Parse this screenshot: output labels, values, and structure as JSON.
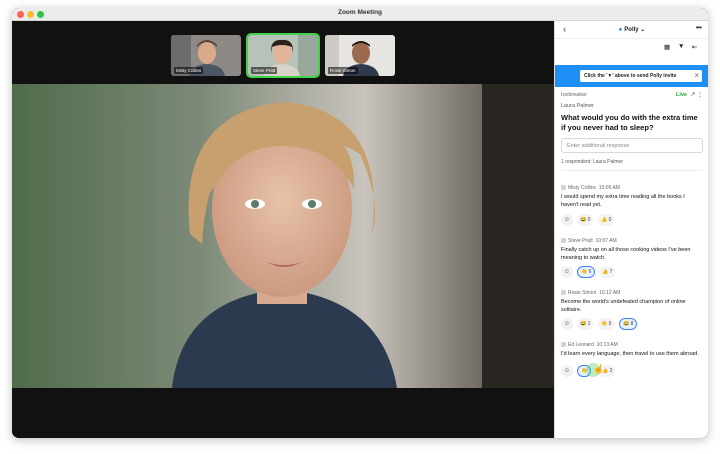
{
  "window": {
    "title": "Zoom Meeting"
  },
  "participants": [
    {
      "name": "Misty Collins",
      "active": false
    },
    {
      "name": "Steve Pratt",
      "active": true
    },
    {
      "name": "Rosie Simon",
      "active": false
    }
  ],
  "panel": {
    "brand": "Polly",
    "banner_text": "Click the '▼' above to send Polly invite",
    "poll_type": "Icebreaker",
    "live_label": "Live",
    "host": "Laura Palmer",
    "question": "What would you do with the extra time if you never had to sleep?",
    "response_placeholder": "Enter additional response",
    "respondent_count": "1 respondent: Laura Palmer",
    "responses": [
      {
        "author": "Misty Collins",
        "time": "10:06 AM",
        "text": "I would spend my extra time reading all the books I haven't read yet.",
        "reactions": [
          {
            "emoji": "😂",
            "count": "0",
            "selected": false
          },
          {
            "emoji": "👍",
            "count": "0",
            "selected": false
          }
        ]
      },
      {
        "author": "Steve Pratt",
        "time": "10:07 AM",
        "text": "Finally catch up on all those cooking videos I've been meaning to watch.",
        "reactions": [
          {
            "emoji": "👏",
            "count": "6",
            "selected": true
          },
          {
            "emoji": "👍",
            "count": "7",
            "selected": false
          }
        ]
      },
      {
        "author": "Rosie Simon",
        "time": "10:12 AM",
        "text": "Become the world's undefeated champion of online solitaire.",
        "reactions": [
          {
            "emoji": "😂",
            "count": "1",
            "selected": false
          },
          {
            "emoji": "👏",
            "count": "5",
            "selected": false
          },
          {
            "emoji": "😂",
            "count": "8",
            "selected": true
          }
        ]
      },
      {
        "author": "Ed Leonard",
        "time": "10:13 AM",
        "text": "I'd learn every language, then travel to use them abroad.",
        "reactions": [
          {
            "emoji": "👏",
            "count": "",
            "selected": true
          },
          {
            "emoji": "👍",
            "count": "2",
            "selected": false
          }
        ]
      }
    ]
  },
  "colors": {
    "accent": "#1e8ff5",
    "live": "#2ea043",
    "active_border": "#3fd24a"
  }
}
